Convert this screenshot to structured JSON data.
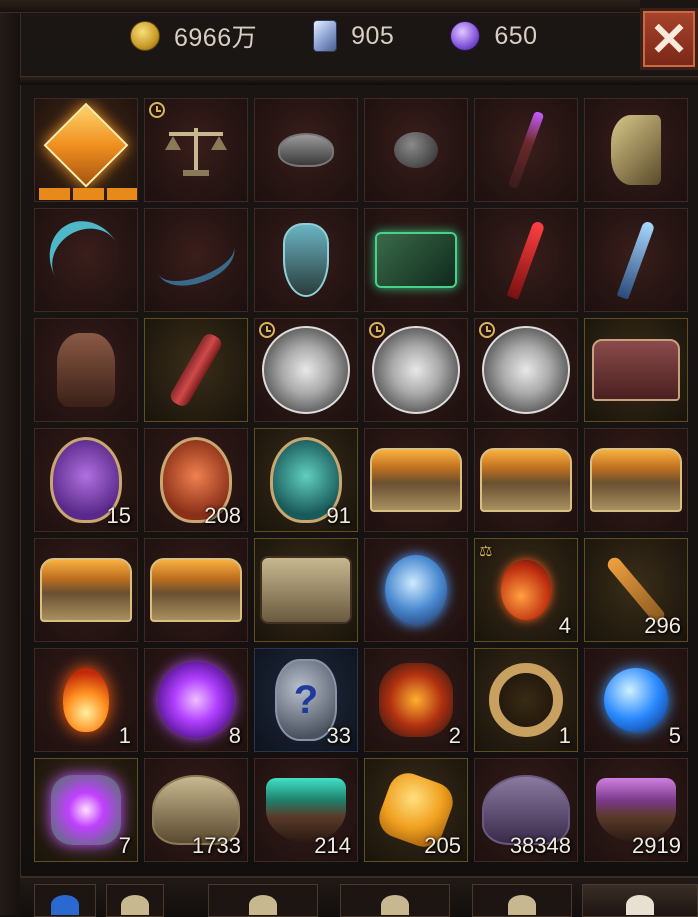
{
  "currencies": [
    {
      "icon": "gold-coin-icon",
      "value": "6966万"
    },
    {
      "icon": "crystal-shard-icon",
      "value": "905"
    },
    {
      "icon": "purple-orb-icon",
      "value": "650"
    }
  ],
  "close_label": "✕",
  "rune_glyph": "?",
  "items": [
    {
      "name": "legendary-rune-item",
      "icon": "diamond",
      "bg": "orange-bg",
      "level": 3,
      "badge": "",
      "count": ""
    },
    {
      "name": "scales-item",
      "icon": "scales",
      "bg": "",
      "badge": "clock",
      "count": ""
    },
    {
      "name": "dark-crown-item",
      "icon": "crown",
      "bg": "",
      "badge": "",
      "count": ""
    },
    {
      "name": "thorn-helm-item",
      "icon": "helm",
      "bg": "",
      "badge": "",
      "count": ""
    },
    {
      "name": "purple-staff-item",
      "icon": "staff",
      "bg": "",
      "badge": "",
      "count": ""
    },
    {
      "name": "bone-axe-item",
      "icon": "axe",
      "bg": "",
      "badge": "",
      "count": ""
    },
    {
      "name": "scythe-item",
      "icon": "scythe",
      "bg": "",
      "badge": "",
      "count": ""
    },
    {
      "name": "crossbow-item",
      "icon": "bow",
      "bg": "",
      "badge": "",
      "count": ""
    },
    {
      "name": "teal-shield-item",
      "icon": "shield-blue",
      "bg": "",
      "badge": "",
      "count": ""
    },
    {
      "name": "green-tome-item",
      "icon": "tome-green",
      "bg": "",
      "badge": "",
      "count": ""
    },
    {
      "name": "red-dagger-item",
      "icon": "dagger-red",
      "bg": "",
      "badge": "",
      "count": ""
    },
    {
      "name": "ice-dagger-item",
      "icon": "dagger-blue",
      "bg": "",
      "badge": "",
      "count": ""
    },
    {
      "name": "body-armor-item",
      "icon": "body-armor",
      "bg": "",
      "badge": "",
      "count": ""
    },
    {
      "name": "red-scroll-item",
      "icon": "scroll",
      "bg": "gold",
      "badge": "",
      "count": ""
    },
    {
      "name": "silver-disc-item-1",
      "icon": "disc",
      "bg": "",
      "badge": "clock",
      "count": ""
    },
    {
      "name": "silver-disc-item-2",
      "icon": "disc",
      "bg": "",
      "badge": "clock",
      "count": ""
    },
    {
      "name": "silver-disc-item-3",
      "icon": "disc",
      "bg": "",
      "badge": "clock",
      "count": ""
    },
    {
      "name": "red-chest-item",
      "icon": "chest-red",
      "bg": "gold",
      "badge": "",
      "count": ""
    },
    {
      "name": "purple-mask-item",
      "icon": "mask purple",
      "bg": "",
      "badge": "",
      "count": "15"
    },
    {
      "name": "orange-mask-item",
      "icon": "mask orange",
      "bg": "",
      "badge": "",
      "count": "208"
    },
    {
      "name": "teal-mask-item",
      "icon": "mask teal",
      "bg": "gold",
      "badge": "",
      "count": "91"
    },
    {
      "name": "gold-chest-item-1",
      "icon": "chest-gold",
      "bg": "",
      "badge": "",
      "count": ""
    },
    {
      "name": "gold-chest-item-2",
      "icon": "chest-gold",
      "bg": "",
      "badge": "",
      "count": ""
    },
    {
      "name": "gold-chest-item-3",
      "icon": "chest-gold",
      "bg": "",
      "badge": "",
      "count": ""
    },
    {
      "name": "gold-chest-item-4",
      "icon": "chest-gold",
      "bg": "",
      "badge": "",
      "count": ""
    },
    {
      "name": "gold-chest-item-5",
      "icon": "chest-gold",
      "bg": "",
      "badge": "",
      "count": ""
    },
    {
      "name": "demon-chest-item",
      "icon": "chest-dark",
      "bg": "gold",
      "badge": "",
      "count": ""
    },
    {
      "name": "blue-crystal-item",
      "icon": "crystal-blue",
      "bg": "",
      "badge": "",
      "count": ""
    },
    {
      "name": "fire-comet-item",
      "icon": "comet",
      "bg": "gold",
      "badge": "scales",
      "count": "4"
    },
    {
      "name": "ornate-key-item",
      "icon": "key",
      "bg": "gold",
      "badge": "",
      "count": "296"
    },
    {
      "name": "flame-essence-item",
      "icon": "flame",
      "bg": "",
      "badge": "",
      "count": "1"
    },
    {
      "name": "purple-vortex-item",
      "icon": "vortex",
      "bg": "",
      "badge": "",
      "count": "8"
    },
    {
      "name": "mystery-rune-item",
      "icon": "rune-stone",
      "bg": "blue",
      "badge": "",
      "count": "33"
    },
    {
      "name": "lava-rune-item",
      "icon": "lava",
      "bg": "",
      "badge": "",
      "count": "2"
    },
    {
      "name": "gold-ring-item",
      "icon": "ring-gold",
      "bg": "gold",
      "badge": "",
      "count": "1"
    },
    {
      "name": "blue-orb-item",
      "icon": "orb-blue",
      "bg": "",
      "badge": "",
      "count": "5"
    },
    {
      "name": "purple-crystal-item",
      "icon": "crystal-purple",
      "bg": "gold",
      "badge": "",
      "count": "7"
    },
    {
      "name": "gold-pauldron-item",
      "icon": "pauldron",
      "bg": "",
      "badge": "",
      "count": "1733"
    },
    {
      "name": "teal-cauldron-item",
      "icon": "cauldron-teal",
      "bg": "",
      "badge": "",
      "count": "214"
    },
    {
      "name": "amber-gem-item",
      "icon": "amber",
      "bg": "gold",
      "badge": "",
      "count": "205"
    },
    {
      "name": "purple-pauldron-item",
      "icon": "pauldron purple",
      "bg": "",
      "badge": "",
      "count": "38348"
    },
    {
      "name": "purple-cauldron-item",
      "icon": "cauldron-purple",
      "bg": "",
      "badge": "",
      "count": "2919"
    }
  ],
  "bottom_tabs": [
    {
      "name": "bottom-tab-1",
      "color": "#2a6ad0"
    },
    {
      "name": "bottom-tab-2",
      "color": "#c8b890"
    },
    {
      "name": "bottom-tab-3",
      "color": "#c8b890"
    },
    {
      "name": "bottom-tab-4",
      "color": "#c8b890"
    },
    {
      "name": "bottom-tab-5",
      "color": "#c8b890"
    },
    {
      "name": "bottom-tab-6",
      "color": "#e8e0d0"
    }
  ]
}
